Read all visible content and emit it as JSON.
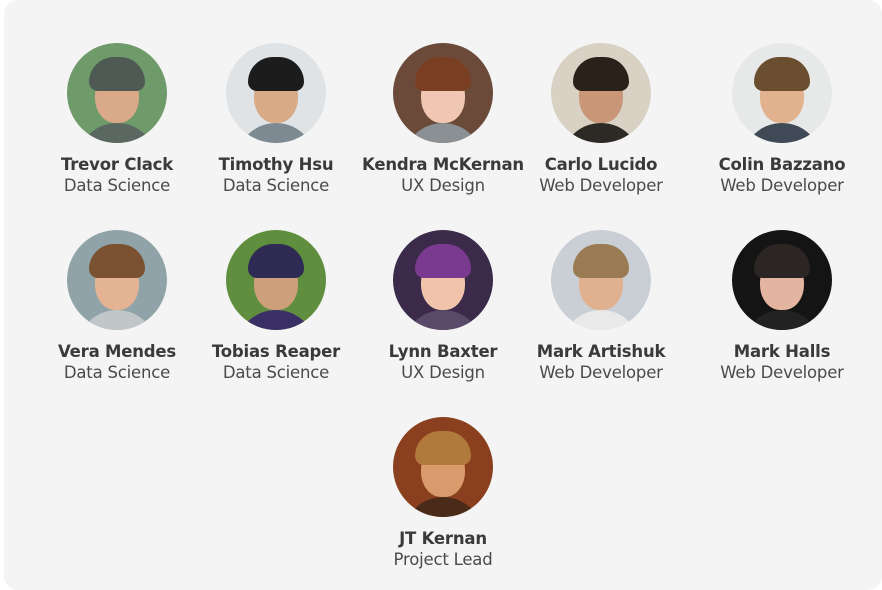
{
  "team": {
    "members": [
      {
        "name": "Trevor Clack",
        "role": "Data Science",
        "photo": "hooded-outdoors-portrait",
        "colors": {
          "bg": "#6f9a6a",
          "hair": "#4f5a55",
          "skin": "#d9a98a",
          "body": "#5b6761"
        }
      },
      {
        "name": "Timothy Hsu",
        "role": "Data Science",
        "photo": "glasses-portrait",
        "colors": {
          "bg": "#dfe3e6",
          "hair": "#1c1c1c",
          "skin": "#d8ab86",
          "body": "#7d8a92"
        }
      },
      {
        "name": "Kendra McKernan",
        "role": "UX Design",
        "photo": "red-lipstick-portrait",
        "colors": {
          "bg": "#6b4a3a",
          "hair": "#7a3f22",
          "skin": "#f0c7b2",
          "body": "#8b9095"
        }
      },
      {
        "name": "Carlo Lucido",
        "role": "Web Developer",
        "photo": "mustache-beard-portrait",
        "colors": {
          "bg": "#d9d2c4",
          "hair": "#2a211b",
          "skin": "#c99677",
          "body": "#2d2925"
        }
      },
      {
        "name": "Colin Bazzano",
        "role": "Web Developer",
        "photo": "smiling-man-portrait",
        "colors": {
          "bg": "#e7e8e8",
          "hair": "#6a4e2f",
          "skin": "#e1b28d",
          "body": "#3f4a56"
        }
      },
      {
        "name": "Vera Mendes",
        "role": "Data Science",
        "photo": "long-hair-smile-portrait",
        "colors": {
          "bg": "#8fa3a9",
          "hair": "#7a5232",
          "skin": "#e3b394",
          "body": "#c1c6c9"
        }
      },
      {
        "name": "Tobias Reaper",
        "role": "Data Science",
        "photo": "seated-outdoors-portrait",
        "colors": {
          "bg": "#5f8f3e",
          "hair": "#2f2b55",
          "skin": "#cf9f7c",
          "body": "#3a2f66"
        }
      },
      {
        "name": "Lynn Baxter",
        "role": "UX Design",
        "photo": "curly-purple-hair-portrait",
        "colors": {
          "bg": "#3b2a4a",
          "hair": "#7a3a8f",
          "skin": "#f0c3aa",
          "body": "#5a4a6a"
        }
      },
      {
        "name": "Mark Artishuk",
        "role": "Web Developer",
        "photo": "short-hair-outdoors-portrait",
        "colors": {
          "bg": "#c9cfd4",
          "hair": "#9b7b54",
          "skin": "#e0b08f",
          "body": "#e9e9e9"
        }
      },
      {
        "name": "Mark Halls",
        "role": "Web Developer",
        "photo": "glasses-dark-background-portrait",
        "colors": {
          "bg": "#141414",
          "hair": "#2b2523",
          "skin": "#e3b5a1",
          "body": "#222222"
        }
      },
      {
        "name": "JT Kernan",
        "role": "Project Lead",
        "photo": "cap-smile-portrait",
        "colors": {
          "bg": "#8a3f1e",
          "hair": "#b07a3c",
          "skin": "#d99b6c",
          "body": "#4a2a18"
        }
      }
    ]
  }
}
